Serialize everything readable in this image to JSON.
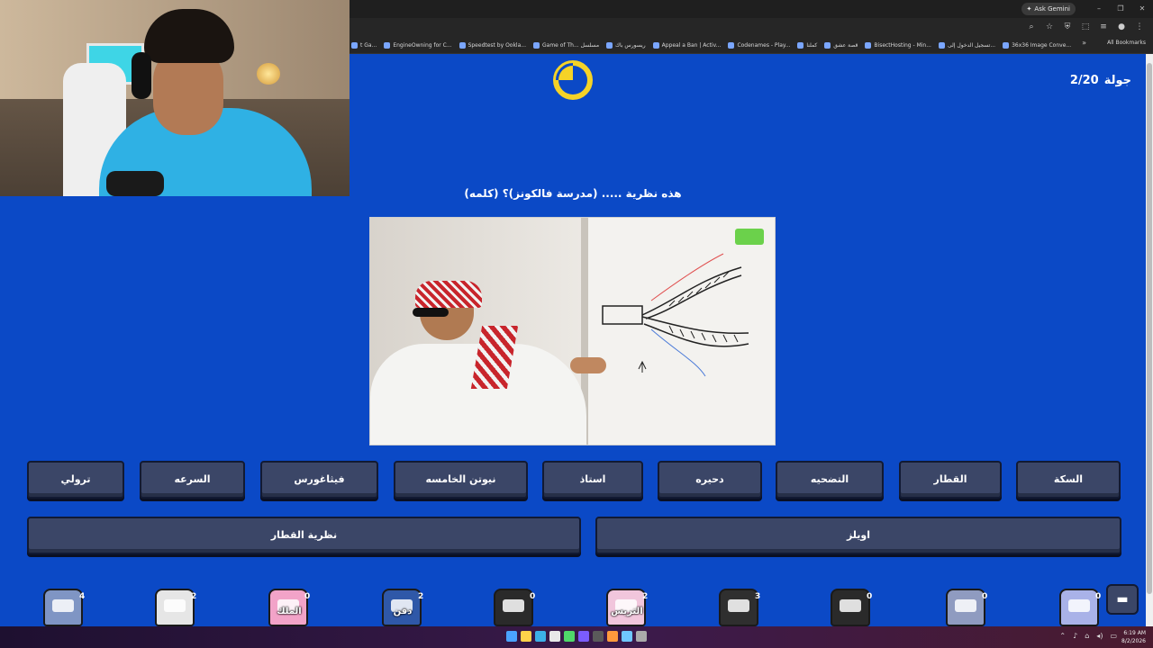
{
  "browser": {
    "ask_gemini": "Ask Gemini",
    "all_bookmarks": "All Bookmarks",
    "bookmarks": [
      "t Ga...",
      "EngineOwning for C...",
      "Speedtest by Ookla...",
      "Game of Th... مسلسل",
      "ريسورس باك",
      "Appeal a Ban | Activ...",
      "Codenames - Play...",
      "كملنا",
      "قصة عشق",
      "BisectHosting - Min...",
      "تسجيل الدخول إلى...",
      "36x36 Image Conve..."
    ]
  },
  "game": {
    "round_label": "جولة",
    "round_value": "2/20",
    "question": "هذه نظرية ..... (مدرسة فالكونز)؟ (كلمه)",
    "answers_row1": [
      "السكة",
      "القطار",
      "التضحيه",
      "دحيره",
      "استاذ",
      "نيوتن الخامسه",
      "فيثاغورس",
      "السرعه",
      "ترولي"
    ],
    "answers_row2": [
      "اويلز",
      "نظرية القطار"
    ],
    "players": [
      {
        "score": "4",
        "color": "#7f95c4"
      },
      {
        "score": "2",
        "color": "#e6e6e6"
      },
      {
        "score": "0",
        "color": "#f2a3c8"
      },
      {
        "score": "2",
        "color": "#2f58a8"
      },
      {
        "score": "0",
        "color": "#2a2a2a"
      },
      {
        "score": "2",
        "color": "#f1c6dc"
      },
      {
        "score": "3",
        "color": "#2f2f2f"
      },
      {
        "score": "0",
        "color": "#2a2a2a"
      },
      {
        "score": "0",
        "color": "#8f9bc0"
      },
      {
        "score": "0",
        "color": "#a9b2e8"
      }
    ],
    "player_badges": [
      "الملك",
      "دفن",
      "التريس"
    ]
  },
  "taskbar": {
    "time": "6:19 AM",
    "date": "8/2/2026"
  }
}
